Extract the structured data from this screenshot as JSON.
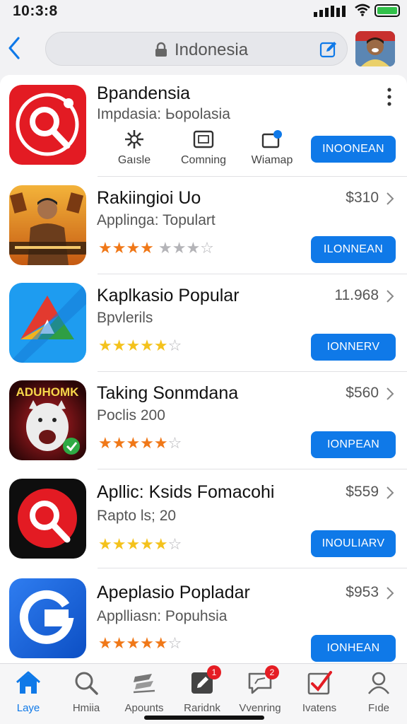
{
  "status": {
    "time": "10:3:8"
  },
  "nav": {
    "address": "Indonesia"
  },
  "featured": {
    "title": "Bpandensia",
    "subtitle": "Impdasia: Ьopolasia",
    "button": "INOONEAN",
    "actions": [
      {
        "label": "Gaısle",
        "icon": "star-burst-icon"
      },
      {
        "label": "Comning",
        "icon": "frame-icon"
      },
      {
        "label": "Wiamap",
        "icon": "folder-badge-icon"
      }
    ]
  },
  "apps": [
    {
      "title": "Rakiingioi Uo",
      "subtitle": "Applinga: Topulart",
      "price": "$310",
      "button": "ILONNEAN",
      "rating": 4,
      "star_color": "orange"
    },
    {
      "title": "Kaplkasio Popular",
      "subtitle": "Bpvlerils",
      "price": "11.968",
      "button": "IONNERV",
      "rating": 4.5,
      "star_color": "yellow"
    },
    {
      "title": "Taking Sonmdana",
      "subtitle": "Poclis 200",
      "price": "$560",
      "button": "IONPEAN",
      "rating": 4.5,
      "star_color": "orange"
    },
    {
      "title": "Apllic: Ksids Fomacohi",
      "subtitle": "Rapto ls; 20",
      "price": "$559",
      "button": "INOULIARV",
      "rating": 4.5,
      "star_color": "yellow"
    },
    {
      "title": "Apeplasio Popladar",
      "subtitle": "Applliasn: Popuhsia",
      "price": "$953",
      "button": "IONHEAN",
      "rating": 4.5,
      "star_color": "orange"
    }
  ],
  "app_icon_text": {
    "dog_banner": "ADUHOMK"
  },
  "tabs": [
    {
      "label": "Laye",
      "icon": "home-icon",
      "active": true
    },
    {
      "label": "Hmiia",
      "icon": "search-icon"
    },
    {
      "label": "Apounts",
      "icon": "layers-icon"
    },
    {
      "label": "Raridnk",
      "icon": "note-icon",
      "badge": "1"
    },
    {
      "label": "Vvenring",
      "icon": "chat-icon",
      "badge": "2"
    },
    {
      "label": "Ivatens",
      "icon": "check-icon"
    },
    {
      "label": "Fıde",
      "icon": "person-icon"
    }
  ],
  "colors": {
    "accent": "#0f79e8",
    "star_orange": "#f07818",
    "star_yellow": "#f4c21c",
    "badge": "#e51d24"
  }
}
